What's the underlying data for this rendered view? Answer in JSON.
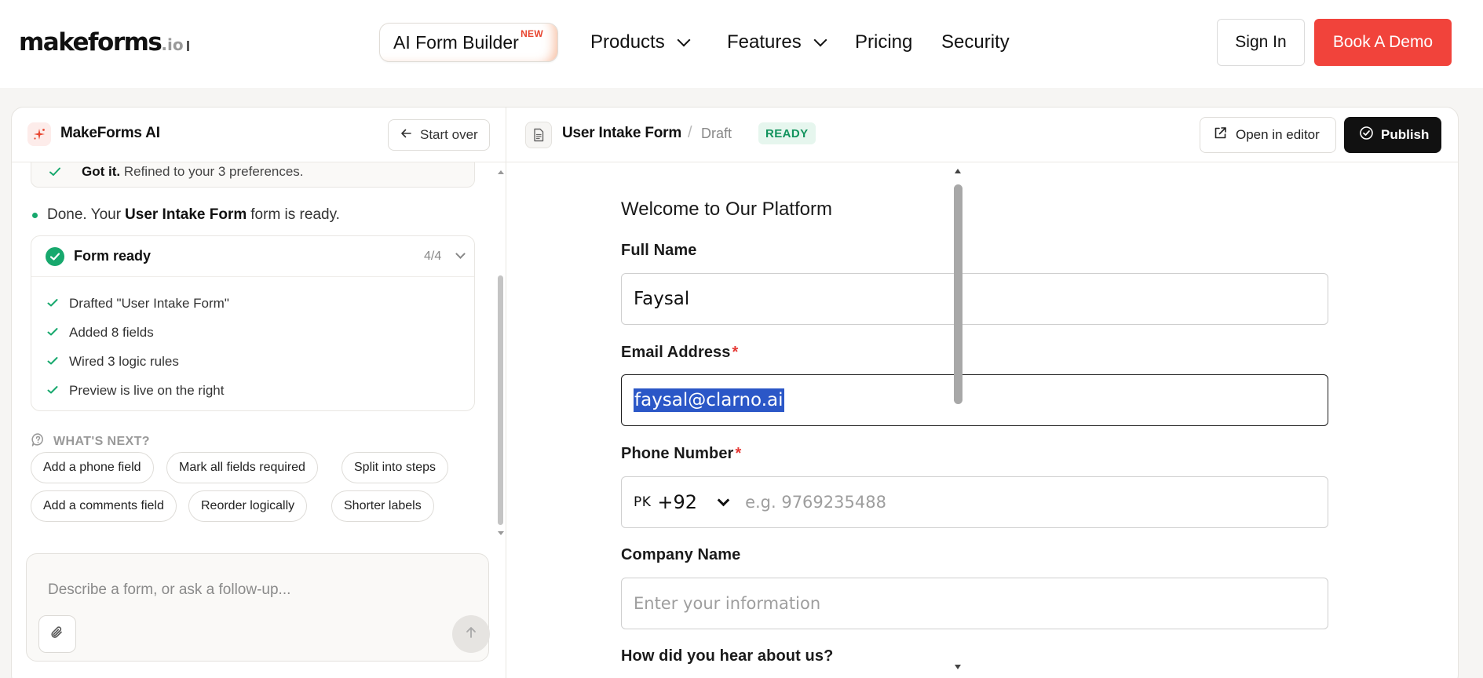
{
  "nav": {
    "logo_main": "makeforms",
    "logo_tld": ".io",
    "ai_builder_label": "AI Form Builder",
    "ai_builder_badge": "NEW",
    "products_label": "Products",
    "features_label": "Features",
    "pricing_label": "Pricing",
    "security_label": "Security",
    "signin_label": "Sign In",
    "book_demo_label": "Book A Demo"
  },
  "assistant": {
    "title": "MakeForms AI",
    "start_over_label": "Start over",
    "prior_message_bold": "Got it.",
    "prior_message_rest": "Refined to your 3 preferences.",
    "done_prefix": "Done. Your",
    "done_form_name": "User Intake Form",
    "done_suffix": "form is ready.",
    "form_ready": {
      "title": "Form ready",
      "count": "4/4",
      "items": [
        "Drafted \"User Intake Form\"",
        "Added 8 fields",
        "Wired 3 logic rules",
        "Preview is live on the right"
      ]
    },
    "whats_next_label": "WHAT'S NEXT?",
    "suggestions": [
      "Add a phone field",
      "Mark all fields required",
      "Split into steps",
      "Add a comments field",
      "Reorder logically",
      "Shorter labels"
    ],
    "composer_placeholder": "Describe a form, or ask a follow-up..."
  },
  "editor": {
    "form_title": "User Intake Form",
    "separator": "/",
    "status_draft": "Draft",
    "status_badge": "READY",
    "open_editor_label": "Open in editor",
    "publish_label": "Publish"
  },
  "preview": {
    "heading": "Welcome to Our Platform",
    "full_name_label": "Full Name",
    "full_name_value": "Faysal",
    "email_label": "Email Address",
    "email_required_mark": "*",
    "email_value": "faysal@clarno.ai",
    "phone_label": "Phone Number",
    "phone_required_mark": "*",
    "phone_country_iso": "PK",
    "phone_country_code": "+92",
    "phone_placeholder": "e.g. 9769235488",
    "company_label": "Company Name",
    "company_placeholder": "Enter your information",
    "hear_about_label": "How did you hear about us?"
  },
  "colors": {
    "brand_red": "#f1433b",
    "success_green": "#17a86d",
    "selection_blue": "#2b57c7",
    "publish_black": "#111111",
    "required_red": "#e53935"
  },
  "icons": {
    "ai_badge": "sparkle-icon",
    "start_over": "arrow-left-icon",
    "check": "check-icon",
    "form_ready": "check-circle-icon",
    "whats_next": "chat-bubble-icon",
    "attach": "paperclip-icon",
    "send": "arrow-up-icon",
    "document": "document-icon",
    "open_editor": "external-link-icon",
    "publish": "check-circle-icon"
  }
}
